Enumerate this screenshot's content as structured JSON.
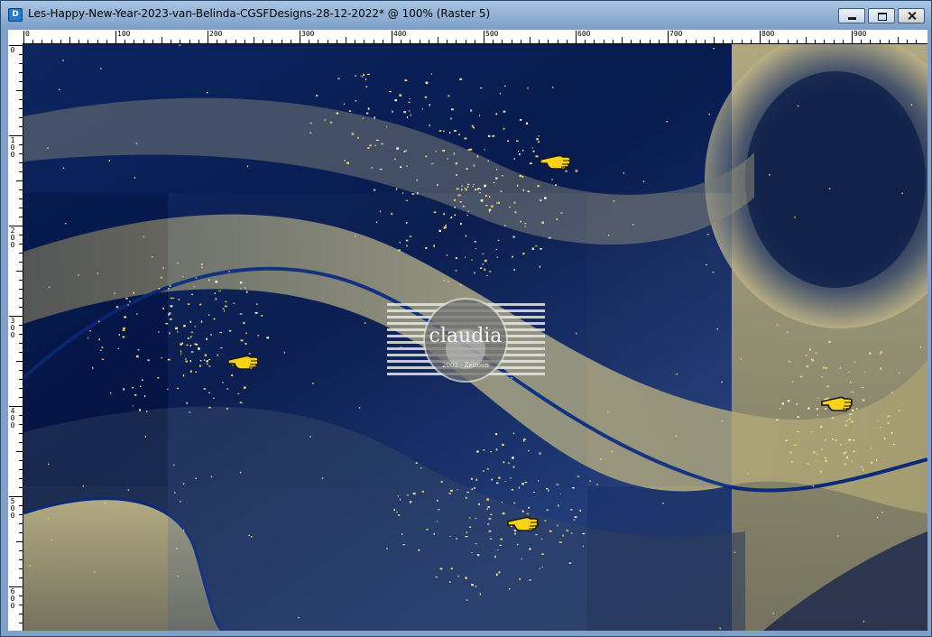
{
  "window": {
    "title": "Les-Happy-New-Year-2023-van-Belinda-CGSFDesigns-28-12-2022* @ 100% (Raster 5)",
    "app_icon_text": "D",
    "controls": {
      "minimize": "minimize-icon",
      "maximize": "maximize-icon",
      "close": "close-icon"
    }
  },
  "rulers": {
    "horizontal_labels": [
      "0",
      "100",
      "200",
      "300",
      "400",
      "500",
      "600",
      "700",
      "800",
      "900"
    ],
    "vertical_labels": [
      "0",
      "100",
      "200",
      "300",
      "400",
      "500",
      "600"
    ]
  },
  "canvas": {
    "watermark": {
      "text": "claudia",
      "subtext": "2002 - Zeitoun"
    },
    "pointer_icons": [
      "pointing-hand-icon",
      "pointing-hand-icon",
      "pointing-hand-icon",
      "pointing-hand-icon"
    ],
    "colors": {
      "navy": "#0b1f55",
      "khaki": "#b8ae7c",
      "gold": "#e8cf78"
    }
  }
}
